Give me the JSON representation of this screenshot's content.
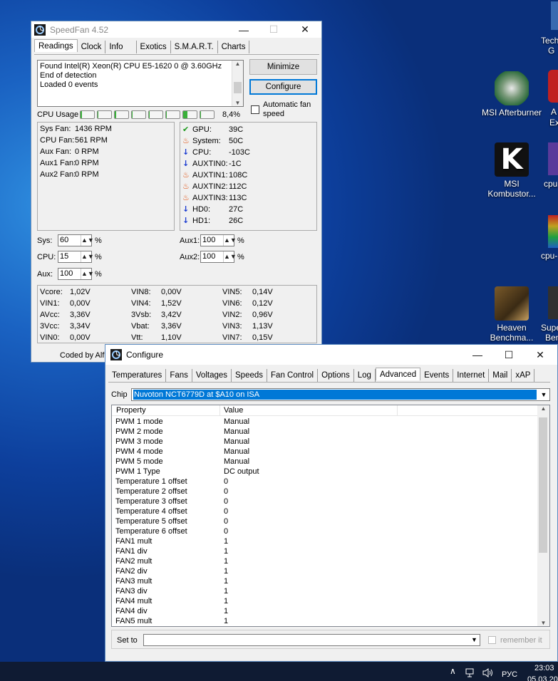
{
  "desktop": {
    "icons": [
      {
        "label": "MSI Afterburner",
        "id": "afterburner"
      },
      {
        "label": "MSI Kombustor...",
        "id": "kombustor"
      },
      {
        "label": "Heaven Benchma...",
        "id": "heaven"
      }
    ],
    "edge_labels": [
      "Tech",
      "G",
      "A",
      "Ex",
      "cpu",
      "cpu-",
      "Supe",
      "Ben"
    ]
  },
  "speedfan": {
    "title": "SpeedFan 4.52",
    "tabs": [
      "Readings",
      "Clock",
      "Info",
      "Exotics",
      "S.M.A.R.T.",
      "Charts"
    ],
    "log": [
      "Found Intel(R) Xeon(R) CPU E5-1620 0 @ 3.60GHz",
      "End of detection",
      "Loaded 0 events"
    ],
    "minimize_label": "Minimize",
    "configure_label": "Configure",
    "cpu_usage_label": "CPU Usage",
    "cpu_usage_value": "8,4%",
    "cpu_core_bars": [
      0.12,
      0.05,
      0.1,
      0.04,
      0.06,
      0.05,
      0.3,
      0.06
    ],
    "auto_fan_label": "Automatic fan speed",
    "fans": [
      {
        "name": "Sys Fan:",
        "value": "1436 RPM"
      },
      {
        "name": "CPU Fan:",
        "value": "561 RPM"
      },
      {
        "name": "Aux Fan:",
        "value": "0 RPM"
      },
      {
        "name": "Aux1 Fan:",
        "value": "0 RPM"
      },
      {
        "name": "Aux2 Fan:",
        "value": "0 RPM"
      }
    ],
    "temps": [
      {
        "icon": "check-icon",
        "name": "GPU:",
        "value": "39C"
      },
      {
        "icon": "flame-icon",
        "name": "System:",
        "value": "50C"
      },
      {
        "icon": "down-arrow-icon",
        "name": "CPU:",
        "value": "-103C"
      },
      {
        "icon": "down-arrow-icon",
        "name": "AUXTIN0:",
        "value": "-1C"
      },
      {
        "icon": "flame-icon",
        "name": "AUXTIN1:",
        "value": "108C"
      },
      {
        "icon": "flame-icon",
        "name": "AUXTIN2:",
        "value": "112C"
      },
      {
        "icon": "flame-icon",
        "name": "AUXTIN3:",
        "value": "113C"
      },
      {
        "icon": "down-arrow-icon",
        "name": "HD0:",
        "value": "27C"
      },
      {
        "icon": "down-arrow-icon",
        "name": "HD1:",
        "value": "26C"
      }
    ],
    "speeds": {
      "sys_label": "Sys:",
      "sys": "60",
      "cpu_label": "CPU:",
      "cpu": "15",
      "aux_label": "Aux:",
      "aux": "100",
      "aux1_label": "Aux1:",
      "aux1": "100",
      "aux2_label": "Aux2:",
      "aux2": "100",
      "pct": "%"
    },
    "voltages": [
      [
        {
          "n": "Vcore:",
          "v": "1,02V"
        },
        {
          "n": "VIN1:",
          "v": "0,00V"
        },
        {
          "n": "AVcc:",
          "v": "3,36V"
        },
        {
          "n": "3Vcc:",
          "v": "3,34V"
        },
        {
          "n": "VIN0:",
          "v": "0,00V"
        }
      ],
      [
        {
          "n": "VIN8:",
          "v": "0,00V"
        },
        {
          "n": "VIN4:",
          "v": "1,52V"
        },
        {
          "n": "3Vsb:",
          "v": "3,42V"
        },
        {
          "n": "Vbat:",
          "v": "3,36V"
        },
        {
          "n": "Vtt:",
          "v": "1,10V"
        }
      ],
      [
        {
          "n": "VIN5:",
          "v": "0,14V"
        },
        {
          "n": "VIN6:",
          "v": "0,12V"
        },
        {
          "n": "VIN2:",
          "v": "0,96V"
        },
        {
          "n": "VIN3:",
          "v": "1,13V"
        },
        {
          "n": "VIN7:",
          "v": "0,15V"
        }
      ]
    ],
    "footer": "Coded by Alfr"
  },
  "configure": {
    "title": "Configure",
    "tabs": [
      "Temperatures",
      "Fans",
      "Voltages",
      "Speeds",
      "Fan Control",
      "Options",
      "Log",
      "Advanced",
      "Events",
      "Internet",
      "Mail",
      "xAP"
    ],
    "chip_label": "Chip",
    "chip_value": "Nuvoton NCT6779D at $A10 on ISA",
    "col_property": "Property",
    "col_value": "Value",
    "rows": [
      [
        "PWM 1 mode",
        "Manual"
      ],
      [
        "PWM 2 mode",
        "Manual"
      ],
      [
        "PWM 3 mode",
        "Manual"
      ],
      [
        "PWM 4 mode",
        "Manual"
      ],
      [
        "PWM 5 mode",
        "Manual"
      ],
      [
        "PWM 1 Type",
        "DC output"
      ],
      [
        "Temperature 1 offset",
        "0"
      ],
      [
        "Temperature 2 offset",
        "0"
      ],
      [
        "Temperature 3 offset",
        "0"
      ],
      [
        "Temperature 4 offset",
        "0"
      ],
      [
        "Temperature 5 offset",
        "0"
      ],
      [
        "Temperature 6 offset",
        "0"
      ],
      [
        "FAN1 mult",
        "1"
      ],
      [
        "FAN1 div",
        "1"
      ],
      [
        "FAN2 mult",
        "1"
      ],
      [
        "FAN2 div",
        "1"
      ],
      [
        "FAN3 mult",
        "1"
      ],
      [
        "FAN3 div",
        "1"
      ],
      [
        "FAN4 mult",
        "1"
      ],
      [
        "FAN4 div",
        "1"
      ],
      [
        "FAN5 mult",
        "1"
      ]
    ],
    "set_to_label": "Set to",
    "remember_label": "remember it"
  },
  "taskbar": {
    "lang": "РУС",
    "time": "23:03",
    "date": "05.03.20"
  }
}
